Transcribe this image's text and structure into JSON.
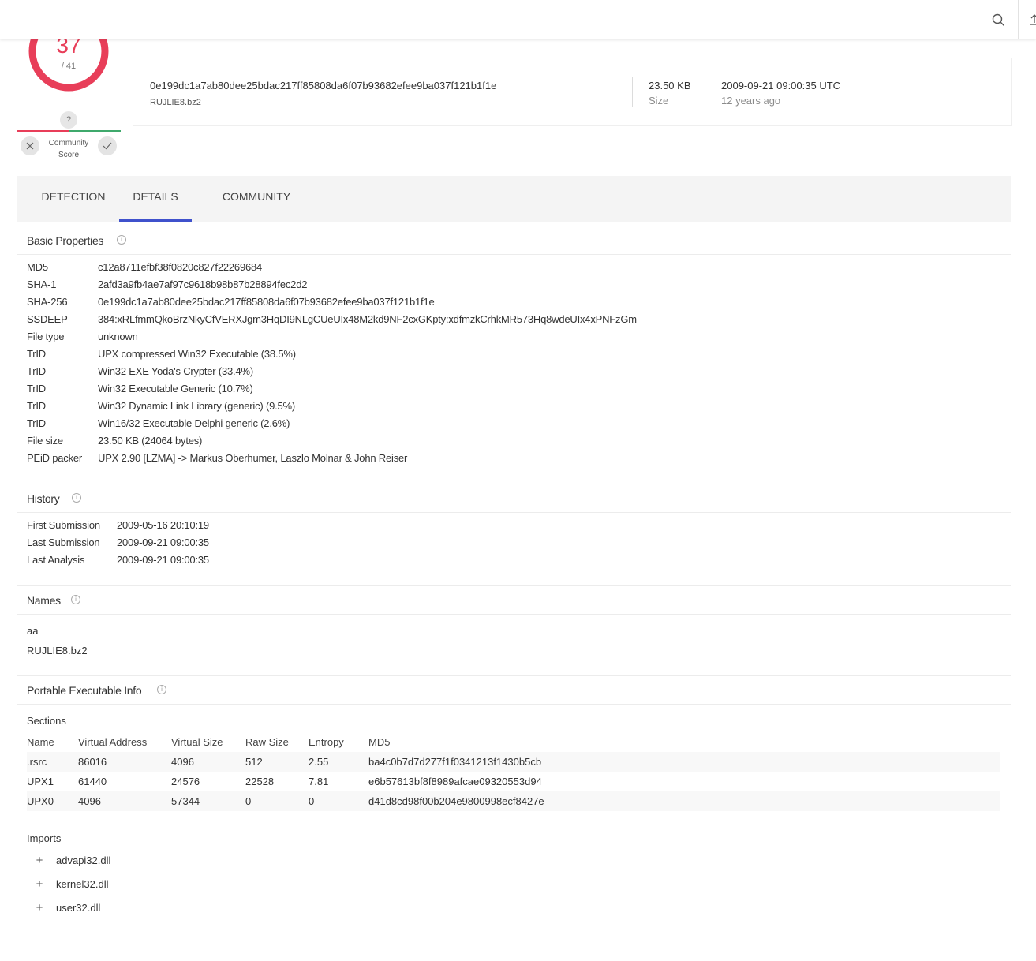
{
  "score": {
    "detections": "37",
    "total": "/ 41"
  },
  "community": {
    "unknown_mark": "?",
    "label_line1": "Community",
    "label_line2": "Score"
  },
  "file": {
    "sha256": "0e199dc1a7ab80dee25bdac217ff85808da6f07b93682efee9ba037f121b1f1e",
    "name": "RUJLIE8.bz2",
    "size": "23.50 KB",
    "size_label": "Size",
    "date": "2009-09-21 09:00:35 UTC",
    "date_relative": "12 years ago"
  },
  "tabs": [
    {
      "label": "DETECTION",
      "active": false
    },
    {
      "label": "DETAILS",
      "active": true
    },
    {
      "label": "COMMUNITY",
      "active": false
    }
  ],
  "basic_properties": {
    "title": "Basic Properties",
    "rows": [
      {
        "key": "MD5",
        "value": "c12a8711efbf38f0820c827f22269684"
      },
      {
        "key": "SHA-1",
        "value": "2afd3a9fb4ae7af97c9618b98b87b28894fec2d2"
      },
      {
        "key": "SHA-256",
        "value": "0e199dc1a7ab80dee25bdac217ff85808da6f07b93682efee9ba037f121b1f1e"
      },
      {
        "key": "SSDEEP",
        "value": "384:xRLfmmQkoBrzNkyCfVERXJgm3HqDI9NLgCUeUIx48M2kd9NF2cxGKpty:xdfmzkCrhkMR573Hq8wdeUIx4xPNFzGm"
      },
      {
        "key": "File type",
        "value": "unknown"
      },
      {
        "key": "TrID",
        "value": "UPX compressed Win32 Executable (38.5%)"
      },
      {
        "key": "TrID",
        "value": "Win32 EXE Yoda's Crypter (33.4%)"
      },
      {
        "key": "TrID",
        "value": "Win32 Executable Generic (10.7%)"
      },
      {
        "key": "TrID",
        "value": "Win32 Dynamic Link Library (generic) (9.5%)"
      },
      {
        "key": "TrID",
        "value": "Win16/32 Executable Delphi generic (2.6%)"
      },
      {
        "key": "File size",
        "value": "23.50 KB (24064 bytes)"
      },
      {
        "key": "PEiD packer",
        "value": "UPX 2.90 [LZMA] -> Markus Oberhumer, Laszlo Molnar & John Reiser"
      }
    ]
  },
  "history": {
    "title": "History",
    "rows": [
      {
        "key": "First Submission",
        "value": "2009-05-16 20:10:19"
      },
      {
        "key": "Last Submission",
        "value": "2009-09-21 09:00:35"
      },
      {
        "key": "Last Analysis",
        "value": "2009-09-21 09:00:35"
      }
    ]
  },
  "names": {
    "title": "Names",
    "items": [
      "aa",
      "RUJLIE8.bz2"
    ]
  },
  "pe_info": {
    "title": "Portable Executable Info",
    "sections_title": "Sections",
    "columns": [
      "Name",
      "Virtual Address",
      "Virtual Size",
      "Raw Size",
      "Entropy",
      "MD5"
    ],
    "rows": [
      [
        ".rsrc",
        "86016",
        "4096",
        "512",
        "2.55",
        "ba4c0b7d7d277f1f0341213f1430b5cb"
      ],
      [
        "UPX1",
        "61440",
        "24576",
        "22528",
        "7.81",
        "e6b57613bf8f8989afcae09320553d94"
      ],
      [
        "UPX0",
        "4096",
        "57344",
        "0",
        "0",
        "d41d8cd98f00b204e9800998ecf8427e"
      ]
    ],
    "imports_title": "Imports",
    "imports": [
      "advapi32.dll",
      "kernel32.dll",
      "user32.dll"
    ]
  },
  "colors": {
    "accent": "#3f51cc",
    "malicious": "#e83e59",
    "harmless": "#3fa96c"
  }
}
